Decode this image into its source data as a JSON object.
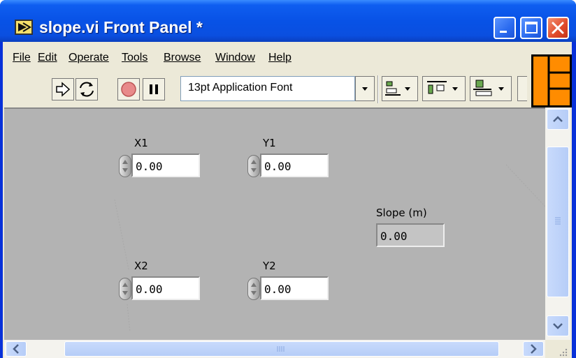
{
  "window": {
    "title": "slope.vi Front Panel *",
    "icons": {
      "app": "labview-vi-icon",
      "minimize": "minimize-icon",
      "maximize": "maximize-icon",
      "close": "close-icon"
    }
  },
  "menu": {
    "items": [
      {
        "label": "File"
      },
      {
        "label": "Edit"
      },
      {
        "label": "Operate"
      },
      {
        "label": "Tools"
      },
      {
        "label": "Browse"
      },
      {
        "label": "Window"
      },
      {
        "label": "Help"
      }
    ]
  },
  "toolbar": {
    "buttons": [
      "run-arrow-icon",
      "run-continuously-icon",
      "abort-icon",
      "pause-icon"
    ],
    "font_selector": "13pt Application Font",
    "dropdowns": [
      "align-objects-icon",
      "distribute-objects-icon",
      "resize-objects-icon"
    ]
  },
  "panel": {
    "x1": {
      "label": "X1",
      "value": "0.00"
    },
    "y1": {
      "label": "Y1",
      "value": "0.00"
    },
    "x2": {
      "label": "X2",
      "value": "0.00"
    },
    "y2": {
      "label": "Y2",
      "value": "0.00"
    },
    "slope": {
      "label": "Slope (m)",
      "value": "0.00"
    }
  },
  "colors": {
    "titlebar": "#0852e6",
    "panel_bg": "#b3b3b3",
    "logo": "#ff8c00"
  }
}
